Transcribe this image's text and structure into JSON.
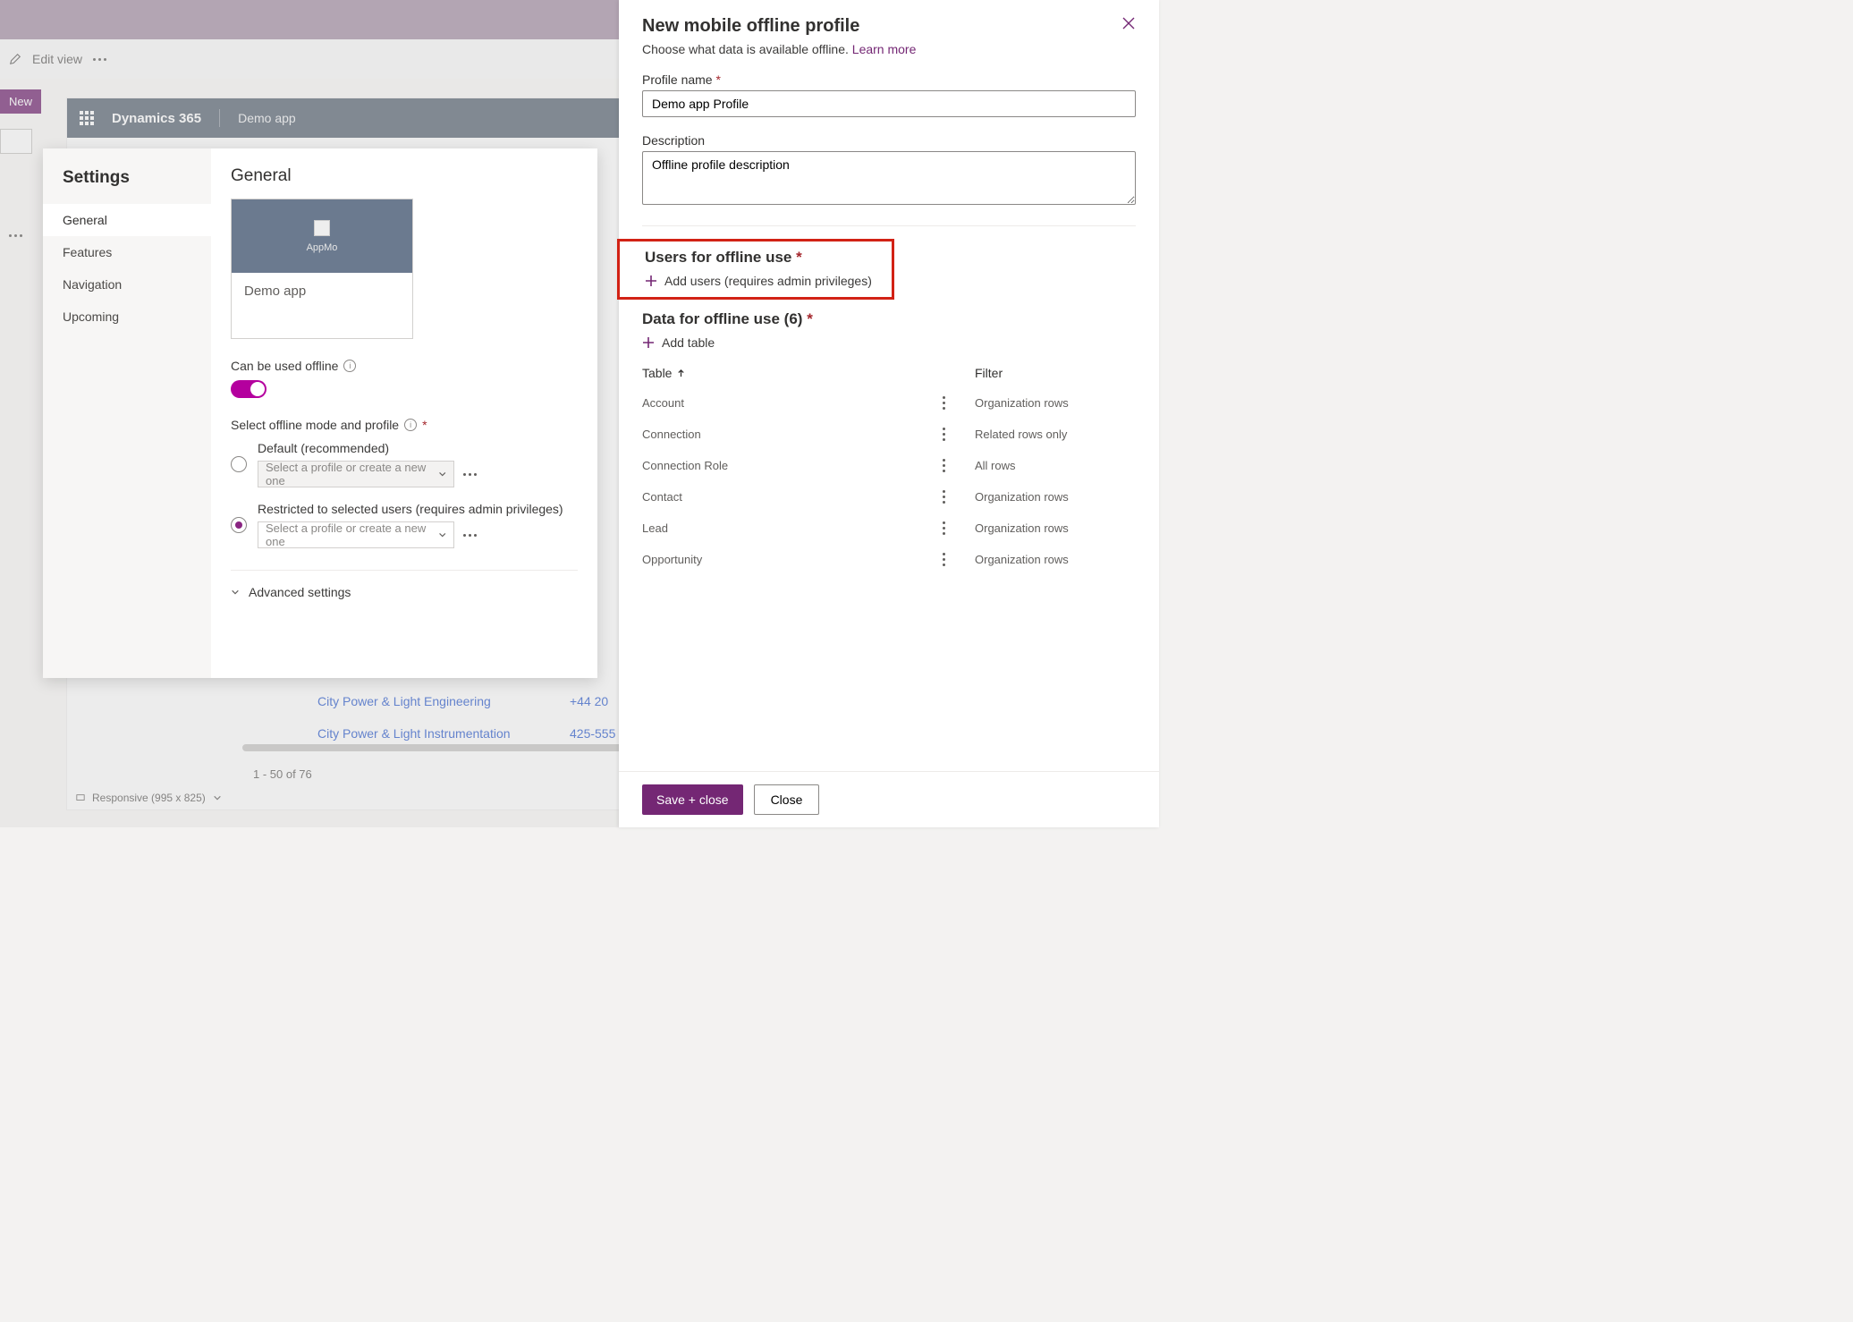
{
  "ribbon": {
    "edit_view": "Edit view"
  },
  "left": {
    "new_btn": "New"
  },
  "preview": {
    "brand": "Dynamics 365",
    "app_name": "Demo app",
    "links": [
      "City Power & Light Engineering",
      "City Power & Light Instrumentation"
    ],
    "phones": [
      "+44 20",
      "425-555"
    ],
    "paging": "1 - 50 of 76",
    "footer": "Responsive (995 x 825)"
  },
  "settings": {
    "title": "Settings",
    "nav": [
      "General",
      "Features",
      "Navigation",
      "Upcoming"
    ],
    "general_heading": "General",
    "app_card_label": "AppMo",
    "app_card_name": "Demo app",
    "offline_label": "Can be used offline",
    "select_mode_label": "Select offline mode and profile",
    "option_default": "Default (recommended)",
    "option_restricted": "Restricted to selected users (requires admin privileges)",
    "profile_placeholder": "Select a profile or create a new one",
    "advanced": "Advanced settings"
  },
  "panel": {
    "title": "New mobile offline profile",
    "subtitle": "Choose what data is available offline.",
    "learn_more": "Learn more",
    "profile_name_label": "Profile name",
    "profile_name_value": "Demo app Profile",
    "description_label": "Description",
    "description_value": "Offline profile description",
    "users_heading": "Users for offline use",
    "add_users_label": "Add users (requires admin privileges)",
    "data_heading": "Data for offline use (6)",
    "add_table_label": "Add table",
    "th_table": "Table",
    "th_filter": "Filter",
    "rows": [
      {
        "name": "Account",
        "filter": "Organization rows"
      },
      {
        "name": "Connection",
        "filter": "Related rows only"
      },
      {
        "name": "Connection Role",
        "filter": "All rows"
      },
      {
        "name": "Contact",
        "filter": "Organization rows"
      },
      {
        "name": "Lead",
        "filter": "Organization rows"
      },
      {
        "name": "Opportunity",
        "filter": "Organization rows"
      }
    ],
    "save_label": "Save + close",
    "close_label": "Close"
  }
}
